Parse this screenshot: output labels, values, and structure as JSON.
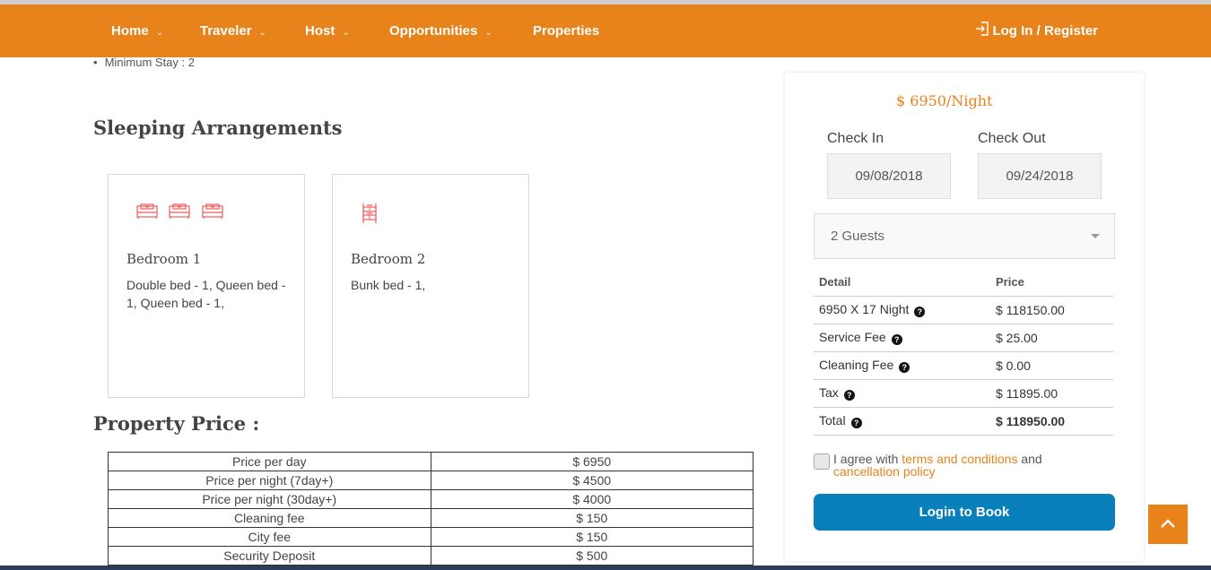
{
  "nav": {
    "items": [
      {
        "label": "Home",
        "has_dropdown": true
      },
      {
        "label": "Traveler",
        "has_dropdown": true
      },
      {
        "label": "Host",
        "has_dropdown": true
      },
      {
        "label": "Opportunities",
        "has_dropdown": true
      },
      {
        "label": "Properties",
        "has_dropdown": false
      }
    ],
    "login_label": "Log In / Register",
    "login_icon": "sign-in-icon",
    "chevron": "⌄"
  },
  "property": {
    "min_stay": "Minimum Stay : 2",
    "sleeping_title": "Sleeping Arrangements",
    "bedrooms": [
      {
        "name": "Bedroom 1",
        "detail": "Double bed - 1, Queen bed - 1, Queen bed - 1,",
        "icon": "double-bed-icon"
      },
      {
        "name": "Bedroom 2",
        "detail": "Bunk bed - 1,",
        "icon": "bunk-bed-icon"
      }
    ],
    "price_title": "Property Price :",
    "prices": [
      {
        "label": "Price per day",
        "value": "$ 6950"
      },
      {
        "label": "Price per night (7day+)",
        "value": "$ 4500"
      },
      {
        "label": "Price per night (30day+)",
        "value": "$ 4000"
      },
      {
        "label": "Cleaning fee",
        "value": "$ 150"
      },
      {
        "label": "City fee",
        "value": "$ 150"
      },
      {
        "label": "Security Deposit",
        "value": "$ 500"
      }
    ]
  },
  "booking": {
    "rate": "$ 6950/Night",
    "check_in_label": "Check In",
    "check_in_value": "09/08/2018",
    "check_out_label": "Check Out",
    "check_out_value": "09/24/2018",
    "guests": "2 Guests",
    "table": {
      "header_detail": "Detail",
      "header_price": "Price",
      "rows": [
        {
          "detail": "6950 X 17 Night",
          "price": "$ 118150.00",
          "info": true
        },
        {
          "detail": "Service Fee",
          "price": "$ 25.00",
          "info": true
        },
        {
          "detail": "Cleaning Fee",
          "price": "$ 0.00",
          "info": true
        },
        {
          "detail": "Tax",
          "price": "$ 11895.00",
          "info": true
        },
        {
          "detail": "Total",
          "price": "$ 118950.00",
          "info": true
        }
      ]
    },
    "agree_prefix": "I agree with",
    "terms_link": "terms and conditions",
    "agree_and": "and",
    "cancellation_link": "cancellation policy",
    "book_button": "Login to Book"
  },
  "colors": {
    "brand": "#e8821a",
    "primary_button": "#0a80ba",
    "bed_icon": "#f05a5a"
  }
}
